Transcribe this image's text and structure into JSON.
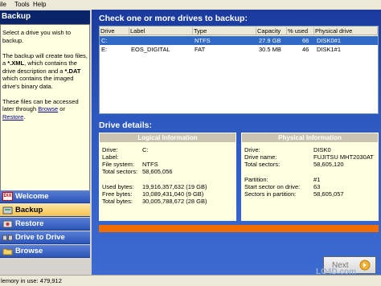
{
  "menu": [
    "ile",
    "Tools",
    "Help"
  ],
  "sidebar": {
    "title": "Backup",
    "description": {
      "line1": "Select a drive you wish to backup.",
      "line2a": "The backup will create two files, a ",
      "xml": "*.XML",
      "line2b": ", which contains the drive description and a ",
      "dat": "*.DAT",
      "line2c": " which contains the imaged drive's binary data.",
      "line3a": "These files can be accessed later through ",
      "browse_link": "Browse",
      "line3b": " or ",
      "restore_link": "Restore",
      "line3c": "."
    },
    "nav": [
      {
        "label": "Welcome",
        "icon": "dix-logo-icon"
      },
      {
        "label": "Backup",
        "icon": "backup-icon"
      },
      {
        "label": "Restore",
        "icon": "restore-icon"
      },
      {
        "label": "Drive to Drive",
        "icon": "drive-to-drive-icon"
      },
      {
        "label": "Browse",
        "icon": "folder-icon"
      }
    ],
    "logo_text": "DIX"
  },
  "main": {
    "drives_title": "Check one or more drives to backup:",
    "columns": [
      "Drive",
      "Label",
      "Type",
      "Capacity",
      "% used",
      "Physical drive"
    ],
    "rows": [
      {
        "drive": "C:",
        "label": "",
        "type": "NTFS",
        "capacity": "27.9 GB",
        "used": "66",
        "physical": "DISK0#1"
      },
      {
        "drive": "E:",
        "label": "EOS_DIGITAL",
        "type": "FAT",
        "capacity": "30.5 MB",
        "used": "46",
        "physical": "DISK1#1"
      }
    ],
    "details_title": "Drive details:",
    "logical": {
      "title": "Logical Information",
      "labels": [
        "Drive:",
        "Label:",
        "File system:",
        "Total sectors:",
        "Used bytes:",
        "Free bytes:",
        "Total bytes:"
      ],
      "values": [
        "C:",
        "",
        "NTFS",
        "58,605,056",
        "19,916,357,632 (19 GB)",
        "10,089,431,040 (9 GB)",
        "30,005,788,672 (28 GB)"
      ]
    },
    "physical": {
      "title": "Physical Information",
      "labels": [
        "Drive:",
        "Drive name:",
        "Total sectors:",
        "Partition:",
        "Start sector on drive:",
        "Sectors in partition:"
      ],
      "values": [
        "DISK0",
        "FUJITSU MHT2030AT",
        "58,605,120",
        "#1",
        "63",
        "58,605,057"
      ]
    },
    "next_label": "Next"
  },
  "status": {
    "memory": "lemory in use: 479,912"
  },
  "watermark": "LO4D.com",
  "colors": {
    "nav_blue": "#2b55b8",
    "active_nav": "#f6c24e",
    "progress": "#f26d00",
    "selection": "#316ac5"
  }
}
